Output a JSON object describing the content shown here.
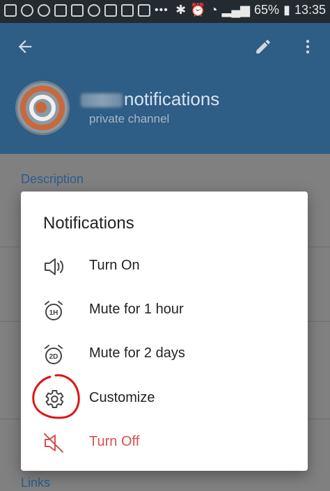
{
  "status_bar": {
    "battery": "65%",
    "time": "13:35",
    "overflow_dots": "•••"
  },
  "header": {
    "channel_name": "notifications",
    "channel_type": "private channel"
  },
  "sections": {
    "description": "Description",
    "links": "Links"
  },
  "dialog": {
    "title": "Notifications",
    "items": [
      {
        "label": "Turn On",
        "icon": "speaker-on-icon"
      },
      {
        "label": "Mute for 1 hour",
        "icon": "alarm-1h-icon"
      },
      {
        "label": "Mute for 2 days",
        "icon": "alarm-2d-icon"
      },
      {
        "label": "Customize",
        "icon": "gear-icon"
      },
      {
        "label": "Turn Off",
        "icon": "speaker-off-icon"
      }
    ]
  },
  "colors": {
    "appbar": "#2e5d86",
    "accent_red": "#d65050",
    "annotation_red": "#e01414"
  }
}
